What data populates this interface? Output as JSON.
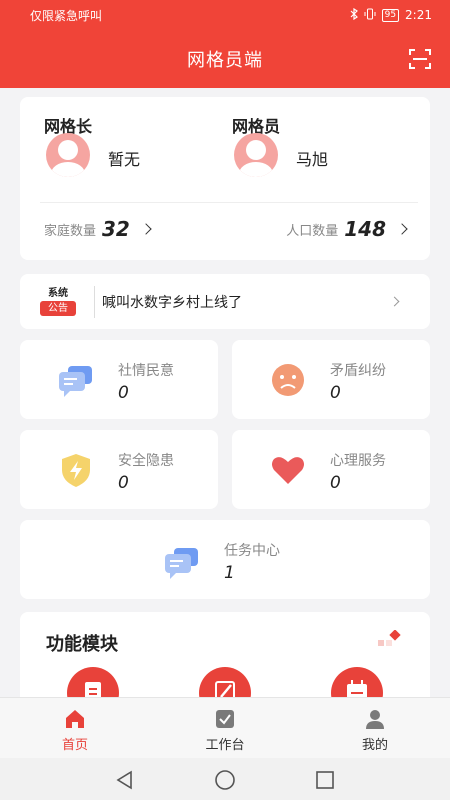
{
  "status_bar": {
    "carrier": "仅限紧急呼叫",
    "battery": "95",
    "time": "2:21"
  },
  "header": {
    "title": "网格员端"
  },
  "members": {
    "leader": {
      "role": "网格长",
      "name": "暂无"
    },
    "member": {
      "role": "网格员",
      "name": "马旭"
    },
    "families": {
      "label": "家庭数量",
      "value": "32"
    },
    "population": {
      "label": "人口数量",
      "value": "148"
    }
  },
  "notice": {
    "badge_top": "系统",
    "badge_bottom": "公告",
    "text": "喊叫水数字乡村上线了"
  },
  "tiles": [
    {
      "label": "社情民意",
      "value": "0",
      "icon": "chat-bubbles-icon"
    },
    {
      "label": "矛盾纠纷",
      "value": "0",
      "icon": "sad-face-icon"
    },
    {
      "label": "安全隐患",
      "value": "0",
      "icon": "shield-bolt-icon"
    },
    {
      "label": "心理服务",
      "value": "0",
      "icon": "heart-icon"
    },
    {
      "label": "任务中心",
      "value": "1",
      "icon": "chat-bubbles-icon"
    }
  ],
  "functions": {
    "title": "功能模块"
  },
  "tabbar": [
    {
      "label": "首页",
      "icon": "home-icon",
      "active": true
    },
    {
      "label": "工作台",
      "icon": "workbench-icon",
      "active": false
    },
    {
      "label": "我的",
      "icon": "user-icon",
      "active": false
    }
  ],
  "colors": {
    "brand": "#f04438",
    "accent": "#e8423a"
  }
}
